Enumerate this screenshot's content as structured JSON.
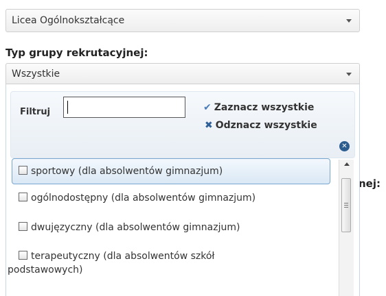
{
  "school_type_select": {
    "value": "Licea Ogólnokształcące"
  },
  "group_type": {
    "label": "Typ grupy rekrutacyjnej:",
    "value": "Wszystkie"
  },
  "right_label_fragment": "nej:",
  "multiselect": {
    "filter_label": "Filtruj",
    "filter_value": "",
    "select_all_icon": "check-icon",
    "select_all_label": "Zaznacz wszystkie",
    "deselect_all_icon": "x-icon",
    "deselect_all_label": "Odznacz wszystkie",
    "close_icon": "close-circle-icon",
    "options": [
      {
        "label": "sportowy (dla absolwentów gimnazjum)",
        "checked": false
      },
      {
        "label": "ogólnodostępny (dla absolwentów gimnazjum)",
        "checked": false
      },
      {
        "label": "dwujęzyczny (dla absolwentów gimnazjum)",
        "checked": false
      },
      {
        "label_line1": "terapeutyczny (dla absolwentów szkół",
        "label_line2": "podstawowych)",
        "checked": false
      }
    ]
  },
  "colors": {
    "accent": "#2d5c8f",
    "highlight_border": "#79a6cf"
  }
}
